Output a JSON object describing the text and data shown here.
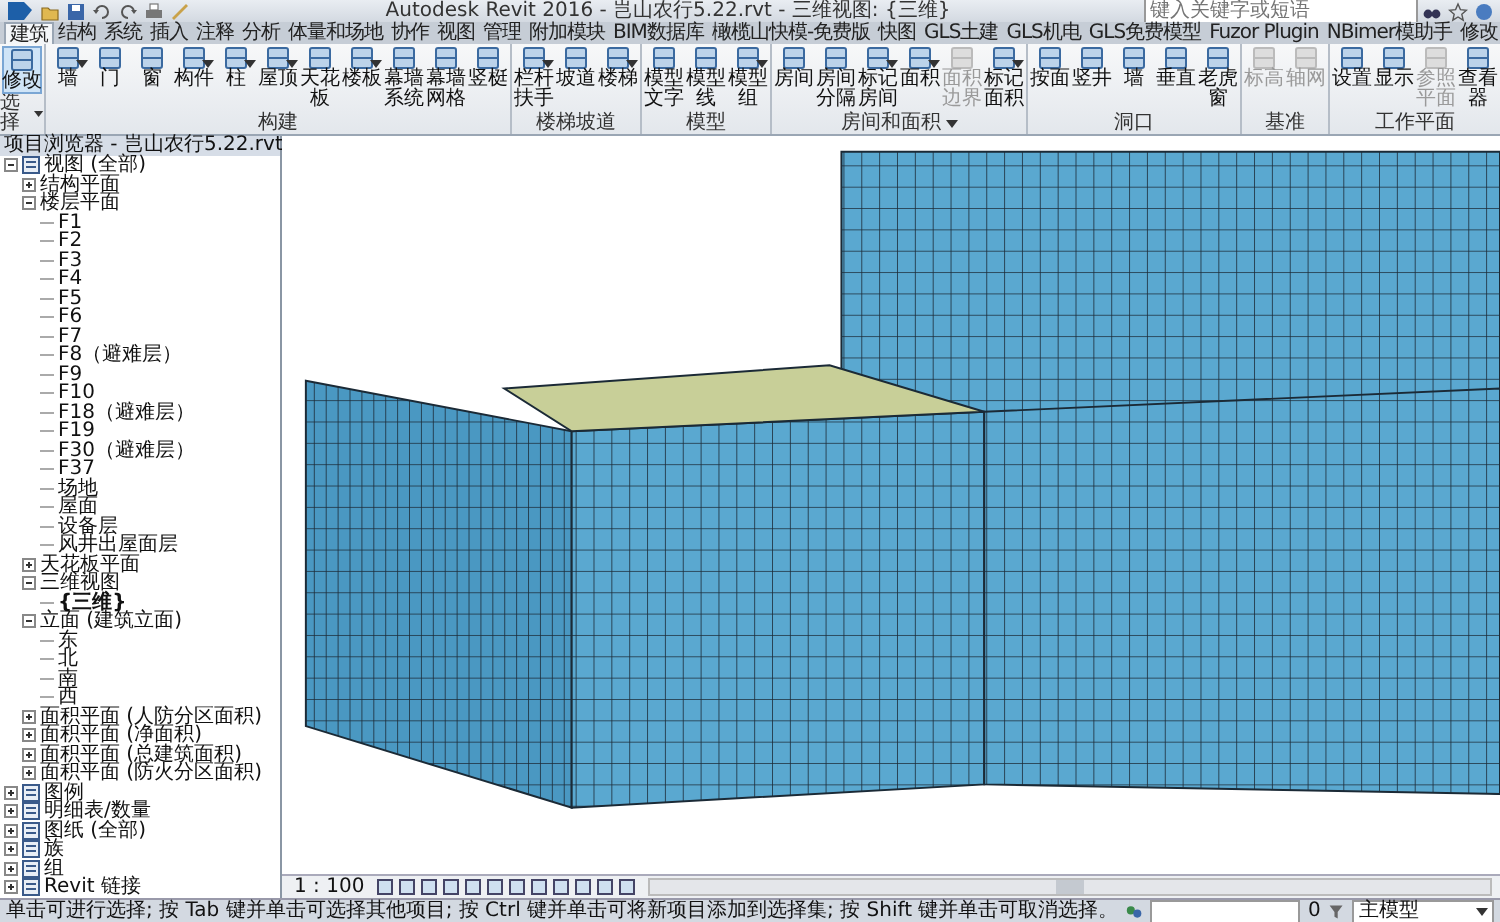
{
  "title_bar": {
    "title": "Autodesk Revit 2016 -   岂山农行5.22.rvt - 三维视图: {三维}",
    "search": {
      "placeholder": "键入关键字或短语"
    }
  },
  "ribbon": {
    "tabs": [
      {
        "label": "建筑",
        "selected": true
      },
      {
        "label": "结构",
        "selected": false
      },
      {
        "label": "系统",
        "selected": false
      },
      {
        "label": "插入",
        "selected": false
      },
      {
        "label": "注释",
        "selected": false
      },
      {
        "label": "分析",
        "selected": false
      },
      {
        "label": "体量和场地",
        "selected": false
      },
      {
        "label": "协作",
        "selected": false
      },
      {
        "label": "视图",
        "selected": false
      },
      {
        "label": "管理",
        "selected": false
      },
      {
        "label": "附加模块",
        "selected": false
      },
      {
        "label": "BIM数据库",
        "selected": false
      },
      {
        "label": "橄榄山快模-免费版",
        "selected": false
      },
      {
        "label": "快图",
        "selected": false
      },
      {
        "label": "GLS土建",
        "selected": false
      },
      {
        "label": "GLS机电",
        "selected": false
      },
      {
        "label": "GLS免费模型",
        "selected": false
      },
      {
        "label": "Fuzor Plugin",
        "selected": false
      },
      {
        "label": "NBimer模助手",
        "selected": false
      },
      {
        "label": "修改",
        "selected": false
      }
    ],
    "panels": [
      {
        "label": "选择",
        "dropdown": true,
        "buttons": [
          {
            "label": "修改",
            "selected": true,
            "disabled": false,
            "dropdown": false
          }
        ]
      },
      {
        "label": "构建",
        "buttons": [
          {
            "label": "墙",
            "disabled": false,
            "dropdown": true
          },
          {
            "label": "门",
            "disabled": false,
            "dropdown": false
          },
          {
            "label": "窗",
            "disabled": false,
            "dropdown": false
          },
          {
            "label": "构件",
            "disabled": false,
            "dropdown": true
          },
          {
            "label": "柱",
            "disabled": false,
            "dropdown": true
          },
          {
            "label": "屋顶",
            "disabled": false,
            "dropdown": true
          },
          {
            "label": "天花板",
            "disabled": false,
            "dropdown": false
          },
          {
            "label": "楼板",
            "disabled": false,
            "dropdown": true
          },
          {
            "label": "幕墙系统",
            "disabled": false,
            "dropdown": false
          },
          {
            "label": "幕墙网格",
            "disabled": false,
            "dropdown": false
          },
          {
            "label": "竖梃",
            "disabled": false,
            "dropdown": false
          }
        ]
      },
      {
        "label": "楼梯坡道",
        "buttons": [
          {
            "label": "栏杆扶手",
            "disabled": false,
            "dropdown": true
          },
          {
            "label": "坡道",
            "disabled": false,
            "dropdown": false
          },
          {
            "label": "楼梯",
            "disabled": false,
            "dropdown": true
          }
        ]
      },
      {
        "label": "模型",
        "buttons": [
          {
            "label": "模型文字",
            "disabled": false,
            "dropdown": false
          },
          {
            "label": "模型线",
            "disabled": false,
            "dropdown": false
          },
          {
            "label": "模型组",
            "disabled": false,
            "dropdown": true
          }
        ]
      },
      {
        "label": "房间和面积",
        "dropdown": true,
        "buttons": [
          {
            "label": "房间",
            "disabled": false,
            "dropdown": false
          },
          {
            "label": "房间分隔",
            "disabled": false,
            "dropdown": false
          },
          {
            "label": "标记房间",
            "disabled": false,
            "dropdown": true
          },
          {
            "label": "面积",
            "disabled": false,
            "dropdown": true
          },
          {
            "label": "面积边界",
            "disabled": true,
            "dropdown": false
          },
          {
            "label": "标记面积",
            "disabled": false,
            "dropdown": true
          }
        ]
      },
      {
        "label": "洞口",
        "buttons": [
          {
            "label": "按面",
            "disabled": false,
            "dropdown": false
          },
          {
            "label": "竖井",
            "disabled": false,
            "dropdown": false
          },
          {
            "label": "墙",
            "disabled": false,
            "dropdown": false
          },
          {
            "label": "垂直",
            "disabled": false,
            "dropdown": false
          },
          {
            "label": "老虎窗",
            "disabled": false,
            "dropdown": false
          }
        ]
      },
      {
        "label": "基准",
        "buttons": [
          {
            "label": "标高",
            "disabled": true,
            "dropdown": false
          },
          {
            "label": "轴网",
            "disabled": true,
            "dropdown": false
          }
        ]
      },
      {
        "label": "工作平面",
        "buttons": [
          {
            "label": "设置",
            "disabled": false,
            "dropdown": false
          },
          {
            "label": "显示",
            "disabled": false,
            "dropdown": false
          },
          {
            "label": "参照平面",
            "disabled": true,
            "dropdown": false
          },
          {
            "label": "查看器",
            "disabled": false,
            "dropdown": false
          }
        ]
      }
    ]
  },
  "project_browser": {
    "title": "项目浏览器 - 岂山农行5.22.rvt",
    "tree": [
      {
        "label": "视图 (全部)",
        "expanded": true,
        "children": [
          {
            "label": "结构平面",
            "expanded": false
          },
          {
            "label": "楼层平面",
            "expanded": true,
            "children": [
              {
                "label": "F1"
              },
              {
                "label": "F2"
              },
              {
                "label": "F3"
              },
              {
                "label": "F4"
              },
              {
                "label": "F5"
              },
              {
                "label": "F6"
              },
              {
                "label": "F7"
              },
              {
                "label": "F8（避难层）"
              },
              {
                "label": "F9"
              },
              {
                "label": "F10"
              },
              {
                "label": "F18（避难层）"
              },
              {
                "label": "F19"
              },
              {
                "label": "F30（避难层）"
              },
              {
                "label": "F37"
              },
              {
                "label": "场地"
              },
              {
                "label": "屋面"
              },
              {
                "label": "设备层"
              },
              {
                "label": "风井出屋面层"
              }
            ]
          },
          {
            "label": "天花板平面",
            "expanded": false
          },
          {
            "label": "三维视图",
            "expanded": true,
            "children": [
              {
                "label": "{三维}",
                "current": true
              }
            ]
          },
          {
            "label": "立面 (建筑立面)",
            "expanded": true,
            "children": [
              {
                "label": "东"
              },
              {
                "label": "北"
              },
              {
                "label": "南"
              },
              {
                "label": "西"
              }
            ]
          },
          {
            "label": "面积平面 (人防分区面积)",
            "expanded": false
          },
          {
            "label": "面积平面 (净面积)",
            "expanded": false
          },
          {
            "label": "面积平面 (总建筑面积)",
            "expanded": false
          },
          {
            "label": "面积平面 (防火分区面积)",
            "expanded": false
          }
        ]
      },
      {
        "label": "图例",
        "expanded": false
      },
      {
        "label": "明细表/数量",
        "expanded": false
      },
      {
        "label": "图纸 (全部)",
        "expanded": false
      },
      {
        "label": "族",
        "expanded": false
      },
      {
        "label": "组",
        "expanded": false
      },
      {
        "label": "Revit 链接",
        "expanded": false
      }
    ]
  },
  "view": {
    "scale": "1 : 100"
  },
  "status_bar": {
    "message": "单击可进行选择; 按 Tab 键并单击可选择其他项目; 按 Ctrl 键并单击可将新项目添加到选择集; 按 Shift 键并单击可取消选择。",
    "selection_count": "0",
    "model": "主模型"
  }
}
